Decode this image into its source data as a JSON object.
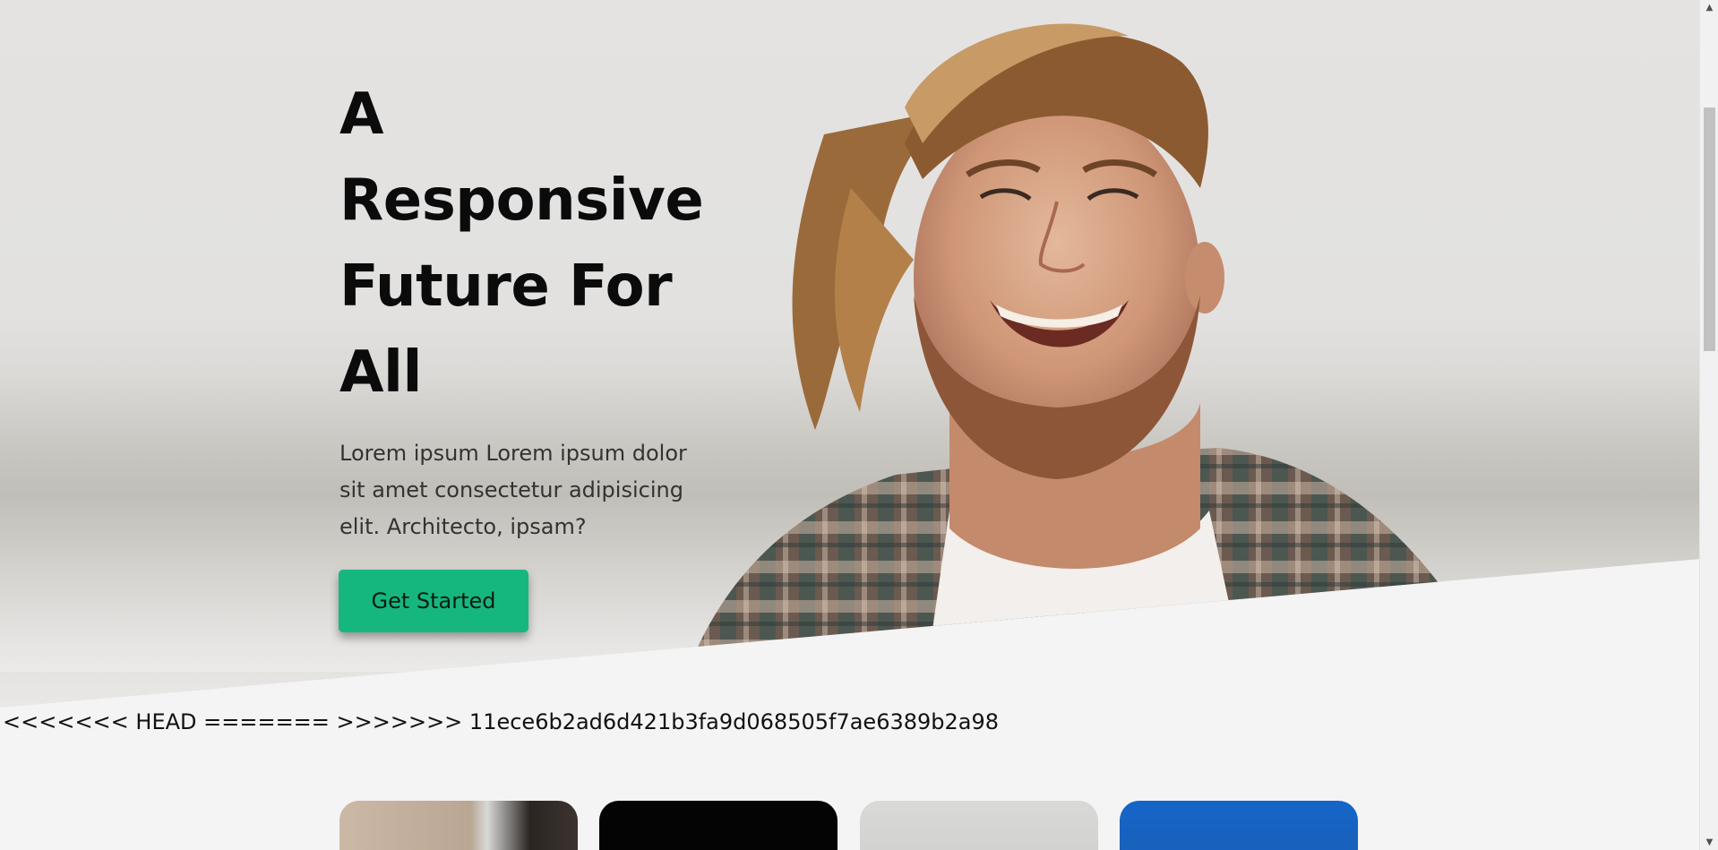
{
  "hero": {
    "title_lines": [
      "A",
      "Responsive",
      "Future For",
      "All"
    ],
    "text": "Lorem ipsum Lorem ipsum dolor sit amet consectetur adipisicing elit. Architecto, ipsam?",
    "cta_label": "Get Started",
    "accent_color": "#16b77f"
  },
  "merge_marker": "<<<<<<< HEAD ======= >>>>>>> 11ece6b2ad6d421b3fa9d068505f7ae6389b2a98",
  "scrollbar": {
    "up_icon": "▲",
    "down_icon": "▼"
  }
}
